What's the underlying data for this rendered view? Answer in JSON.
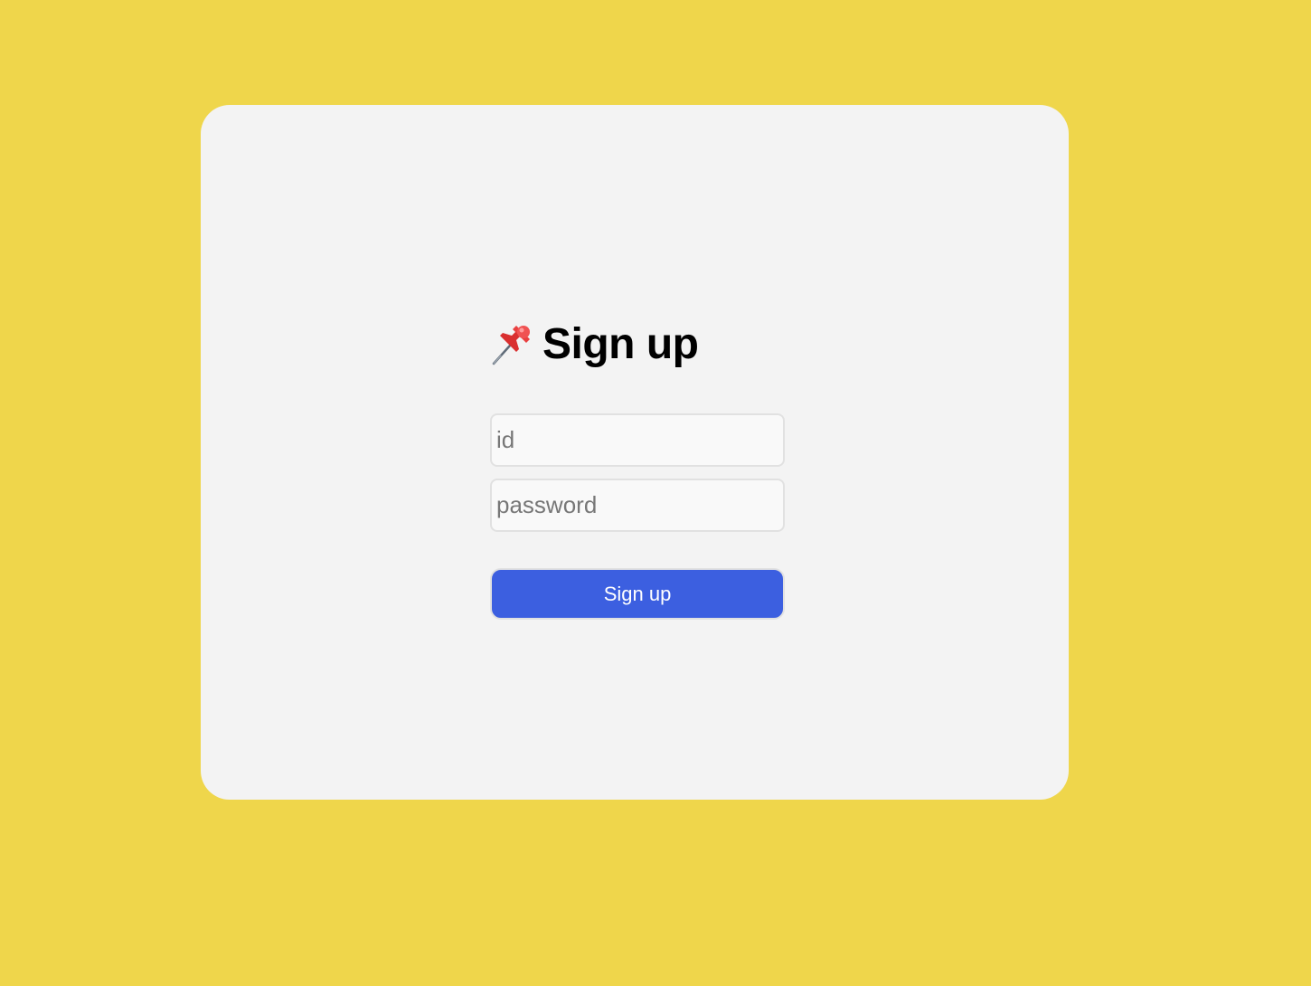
{
  "signup": {
    "title": "Sign up",
    "title_icon": "pushpin-icon",
    "id_placeholder": "id",
    "password_placeholder": "password",
    "submit_label": "Sign up"
  },
  "colors": {
    "page_background": "#efd64b",
    "card_background": "#f3f3f3",
    "button_background": "#3c5fe0",
    "button_text": "#ffffff"
  }
}
